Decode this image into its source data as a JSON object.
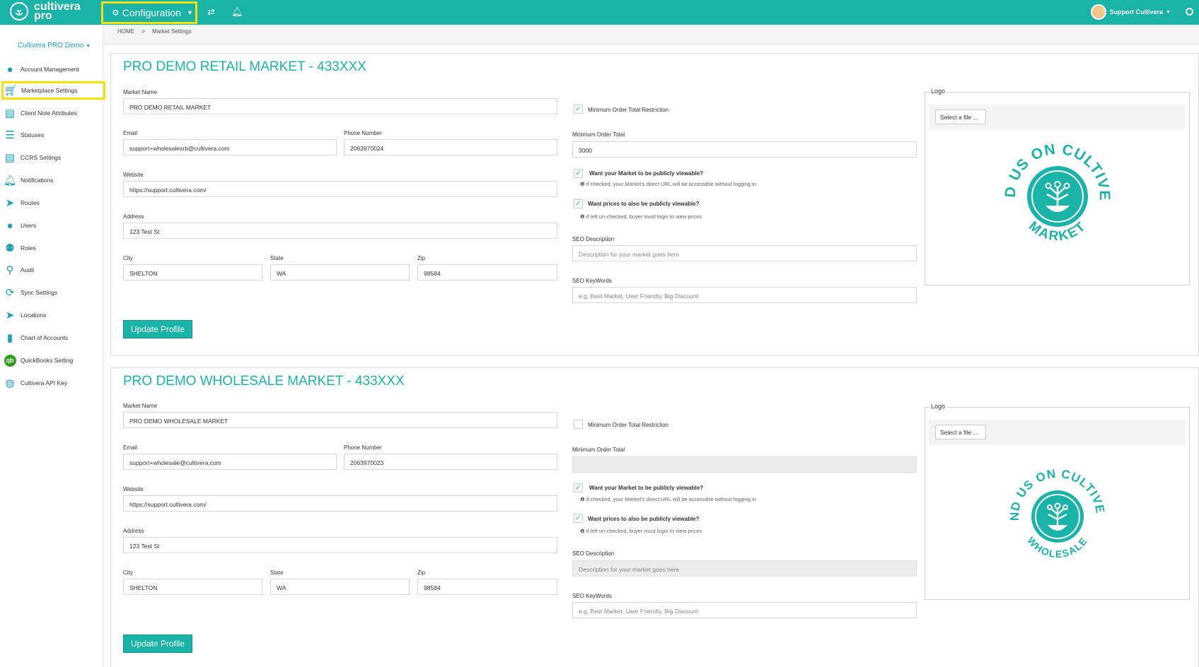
{
  "topbar": {
    "brand_line1": "cultivera",
    "brand_line2": "pro",
    "config_label": "Configuration",
    "user_name": "Support Cultivera"
  },
  "sidebar": {
    "org": "Cultivera PRO Demo",
    "items": [
      {
        "label": "Account Management",
        "icon": "user-icon"
      },
      {
        "label": "Marketplace Settings",
        "icon": "cart-icon"
      },
      {
        "label": "Client Note Attributes",
        "icon": "document-icon"
      },
      {
        "label": "Statuses",
        "icon": "list-icon"
      },
      {
        "label": "CCRS Settings",
        "icon": "document-icon"
      },
      {
        "label": "Notifications",
        "icon": "bell-icon"
      },
      {
        "label": "Routes",
        "icon": "send-icon"
      },
      {
        "label": "Users",
        "icon": "user-icon"
      },
      {
        "label": "Roles",
        "icon": "users-icon"
      },
      {
        "label": "Audit",
        "icon": "key-search-icon"
      },
      {
        "label": "Sync Settings",
        "icon": "sync-icon"
      },
      {
        "label": "Locations",
        "icon": "send-icon"
      },
      {
        "label": "Chart of Accounts",
        "icon": "book-icon"
      },
      {
        "label": "QuickBooks Setting",
        "icon": "quickbooks-icon"
      },
      {
        "label": "Cultivera API Key",
        "icon": "api-icon"
      }
    ]
  },
  "breadcrumb": {
    "home": "HOME",
    "sep": ">",
    "current": "Market Settings"
  },
  "labels": {
    "market_name": "Market Name",
    "email": "Email",
    "phone": "Phone Number",
    "website": "Website",
    "address": "Address",
    "city": "City",
    "state": "State",
    "zip": "Zip",
    "min_order_restriction": "Minimum Order Total Restriction",
    "min_order_total": "Minimum Order Total",
    "public_market": "Want your Market to be publicly viewable?",
    "public_market_hint": "if checked, your Market's direct URL will be accessible without logging in",
    "public_prices": "Want prices to also be publicly viewable?",
    "public_prices_hint": "if left un-checked, buyer must login to view prices",
    "seo_description": "SEO Description",
    "seo_keywords": "SEO KeyWords",
    "seo_description_placeholder": "Description for your market goes here",
    "seo_keywords_placeholder": "e.g: Best Market, User Friendly, Big Discount",
    "logo": "Logo",
    "select_file": "Select a file ...",
    "update_profile": "Update Profile",
    "check_mark": "✓",
    "info_mark": "❶"
  },
  "retail": {
    "title": "PRO DEMO RETAIL MARKET - 433XXX",
    "market_name": "PRO DEMO RETAIL MARKET",
    "email": "support+wholesalesrb@cultivera.com",
    "phone": "2063970024",
    "website": "https://support.cultivera.com/",
    "address": "123 Test St",
    "city": "SHELTON",
    "state": "WA",
    "zip": "98584",
    "min_order_restriction_checked": true,
    "min_order_total": "3000",
    "public_market_checked": true,
    "public_prices_checked": true,
    "seal_text_top": "FIND US ON CULTIVERA",
    "seal_text_bottom": "MARKET"
  },
  "wholesale": {
    "title": "PRO DEMO WHOLESALE MARKET - 433XXX",
    "market_name": "PRO DEMO WHOLESALE MARKET",
    "email": "support+wholesale@cultivera.com",
    "phone": "2063970023",
    "website": "https://support.cultivera.com/",
    "address": "123 Test St",
    "city": "SHELTON",
    "state": "WA",
    "zip": "98584",
    "min_order_restriction_checked": false,
    "min_order_total": "",
    "public_market_checked": true,
    "public_prices_checked": true,
    "seal_text_top": "FIND US ON CULTIVERA",
    "seal_text_bottom": "WHOLESALE"
  },
  "colors": {
    "accent": "#1ab3a8",
    "highlight": "#f5e10a",
    "link": "#1a9fb5"
  }
}
